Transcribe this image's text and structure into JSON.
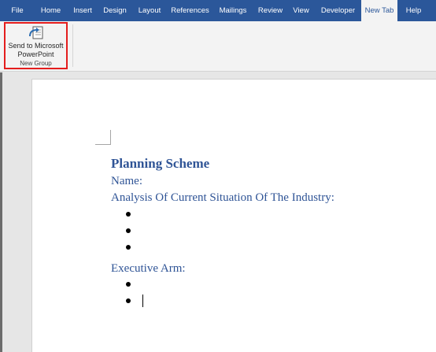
{
  "ribbon_tabs": [
    {
      "label": "File"
    },
    {
      "label": "Home"
    },
    {
      "label": "Insert"
    },
    {
      "label": "Design"
    },
    {
      "label": "Layout"
    },
    {
      "label": "References"
    },
    {
      "label": "Mailings"
    },
    {
      "label": "Review"
    },
    {
      "label": "View"
    },
    {
      "label": "Developer"
    },
    {
      "label": "New Tab",
      "active": true
    },
    {
      "label": "Help"
    }
  ],
  "ribbon": {
    "send_button": {
      "line1": "Send to Microsoft",
      "line2": "PowerPoint",
      "icon": "send-to-powerpoint-icon"
    },
    "group_label": "New Group"
  },
  "document": {
    "title": "Planning Scheme",
    "name_line": "Name:",
    "analysis_heading": "Analysis Of Current Situation Of The Industry:",
    "analysis_bullets": [
      "",
      "",
      ""
    ],
    "executive_heading": "Executive Arm:",
    "executive_bullets": [
      "",
      ""
    ]
  },
  "colors": {
    "tabbar": "#2b579a",
    "ribbon": "#f3f3f3",
    "heading": "#2f5496",
    "highlight": "#e41d1d"
  }
}
